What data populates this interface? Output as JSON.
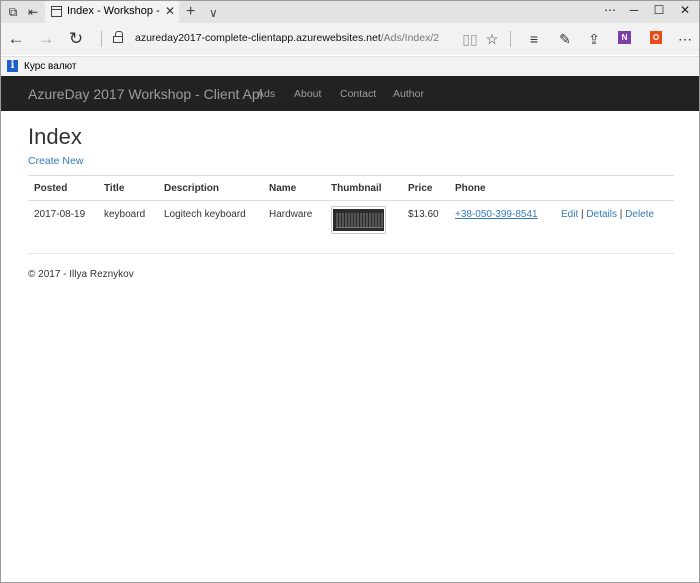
{
  "browser": {
    "tab": {
      "title": "Index - Workshop - Clie",
      "close_glyph": "✕"
    },
    "new_tab_glyph": "+",
    "tab_menu_glyph": "∨",
    "window_buttons": {
      "more": "⋯",
      "minimize": "─",
      "maximize": "☐",
      "close": "✕"
    },
    "address": {
      "host": "azureday2017-complete-clientapp.azurewebsites.net",
      "path": "/Ads/Index/2"
    },
    "favorites": [
      {
        "label": "Курс валют",
        "icon": "i"
      }
    ],
    "icons": {
      "back": "←",
      "forward": "→",
      "refresh": "↻",
      "reading_view": "📖",
      "favorite": "☆",
      "hub": "≡",
      "notes": "✎",
      "share": "⇪",
      "more": "⋯",
      "onenote": "N",
      "office": "O"
    }
  },
  "site": {
    "brand": "AzureDay 2017 Workshop - Client Api",
    "nav": [
      "Ads",
      "About",
      "Contact",
      "Author"
    ]
  },
  "page": {
    "title": "Index",
    "create_link": "Create New",
    "table": {
      "headers": [
        "Posted",
        "Title",
        "Description",
        "Name",
        "Thumbnail",
        "Price",
        "Phone"
      ],
      "rows": [
        {
          "posted": "2017-08-19",
          "title": "keyboard",
          "description": "Logitech keyboard",
          "name": "Hardware",
          "price": "$13.60",
          "phone": "+38-050-399-8541",
          "actions": {
            "edit": "Edit",
            "details": "Details",
            "delete": "Delete",
            "separator": "|"
          }
        }
      ]
    }
  },
  "footer": "© 2017 - Illya Reznykov"
}
